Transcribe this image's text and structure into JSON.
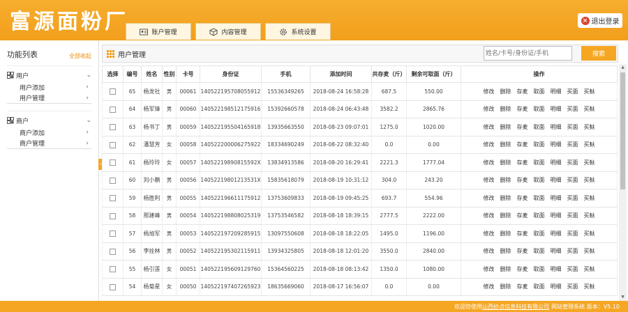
{
  "app": {
    "logo": "富源面粉厂",
    "logout_label": "退出登录"
  },
  "tabs": [
    {
      "label": "账户管理",
      "icon": "user-card-icon"
    },
    {
      "label": "内容管理",
      "icon": "box-icon"
    },
    {
      "label": "系统设置",
      "icon": "gear-icon"
    }
  ],
  "sidebar": {
    "title": "功能列表",
    "collapse_all": "全部收起",
    "groups": [
      {
        "label": "用户",
        "items": [
          "用户添加",
          "用户管理"
        ]
      },
      {
        "label": "商户",
        "items": [
          "商户添加",
          "商户管理"
        ]
      }
    ]
  },
  "main": {
    "title": "用户管理",
    "search_placeholder": "姓名/卡号/身份证/手机",
    "search_button": "搜索",
    "columns": [
      "选择",
      "编号",
      "姓名",
      "性别",
      "卡号",
      "身份证",
      "手机",
      "添加时间",
      "共存麦（斤）",
      "剩余可取面（斤）",
      "操作"
    ],
    "actions": [
      "修改",
      "删除",
      "存麦",
      "取面",
      "明细",
      "买面",
      "买麸"
    ],
    "rows": [
      {
        "id": "65",
        "name": "杨龙社",
        "gender": "男",
        "card": "00061",
        "idcard": "140522195708055912",
        "phone": "15536349265",
        "time": "2018-08-24 16:58:28",
        "wheat": "687.5",
        "flour": "550.00"
      },
      {
        "id": "64",
        "name": "杨军锋",
        "gender": "男",
        "card": "00060",
        "idcard": "140522198512175916",
        "phone": "15392660578",
        "time": "2018-08-24 06:43:48",
        "wheat": "3582.2",
        "flour": "2865.76"
      },
      {
        "id": "63",
        "name": "杨书丁",
        "gender": "男",
        "card": "00059",
        "idcard": "140522195504165918",
        "phone": "13935663550",
        "time": "2018-08-23 09:07:01",
        "wheat": "1275.0",
        "flour": "1020.00"
      },
      {
        "id": "62",
        "name": "潘慧芳",
        "gender": "女",
        "card": "00058",
        "idcard": "140522200006275922",
        "phone": "18334690249",
        "time": "2018-08-22 08:32:40",
        "wheat": "0.0",
        "flour": "0.00"
      },
      {
        "id": "61",
        "name": "杨玲玲",
        "gender": "女",
        "card": "00057",
        "idcard": "14052219890815592X",
        "phone": "13834913586",
        "time": "2018-08-20 16:29:41",
        "wheat": "2221.3",
        "flour": "1777.04"
      },
      {
        "id": "60",
        "name": "刘小鹏",
        "gender": "男",
        "card": "00056",
        "idcard": "14052219801213531X",
        "phone": "15835618079",
        "time": "2018-08-19 10:31:12",
        "wheat": "304.0",
        "flour": "243.20"
      },
      {
        "id": "59",
        "name": "杨胜利",
        "gender": "男",
        "card": "00055",
        "idcard": "140522196611175912",
        "phone": "13753609833",
        "time": "2018-08-19 09:45:25",
        "wheat": "693.7",
        "flour": "554.96"
      },
      {
        "id": "58",
        "name": "邢建峰",
        "gender": "男",
        "card": "00054",
        "idcard": "140522198808025319",
        "phone": "13753546582",
        "time": "2018-08-18 18:39:15",
        "wheat": "2777.5",
        "flour": "2222.00"
      },
      {
        "id": "57",
        "name": "杨旭军",
        "gender": "男",
        "card": "00053",
        "idcard": "140522197209285915",
        "phone": "13097550608",
        "time": "2018-08-18 18:22:05",
        "wheat": "1495.0",
        "flour": "1196.00"
      },
      {
        "id": "56",
        "name": "李拴林",
        "gender": "男",
        "card": "00052",
        "idcard": "140522195302115911",
        "phone": "13934325805",
        "time": "2018-08-18 12:01:20",
        "wheat": "3550.0",
        "flour": "2840.00"
      },
      {
        "id": "55",
        "name": "杨引莲",
        "gender": "女",
        "card": "00051",
        "idcard": "140522195609129760",
        "phone": "15364560225",
        "time": "2018-08-18 08:13:42",
        "wheat": "1350.0",
        "flour": "1080.00"
      },
      {
        "id": "54",
        "name": "杨菊星",
        "gender": "女",
        "card": "00050",
        "idcard": "140522197407265923",
        "phone": "18635669060",
        "time": "2018-08-17 16:56:07",
        "wheat": "0.0",
        "flour": "0.00"
      }
    ]
  },
  "footer": {
    "prefix": "欢迎您使用",
    "company": "山西妙点信息科技有限公司",
    "suffix": "网站管理系统  版本：V5.10"
  },
  "colors": {
    "accent": "#f5a623",
    "accent_dark": "#f29f1c"
  }
}
